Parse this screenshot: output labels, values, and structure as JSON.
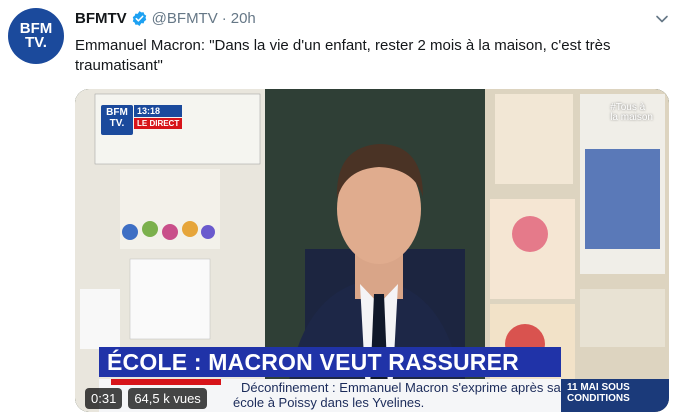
{
  "tweet": {
    "author_name": "BFMTV",
    "handle": "@BFMTV",
    "separator": "·",
    "time": "20h",
    "text": "Emmanuel Macron: \"Dans la vie d'un enfant, rester 2 mois à la maison, c'est très traumatisant\"",
    "avatar_text_line1": "BFM",
    "avatar_text_line2": "TV."
  },
  "video": {
    "channel_logo_line1": "BFM",
    "channel_logo_line2": "TV.",
    "clock": "13:18",
    "live_label": "LE DIRECT",
    "watermark_line1": "#Tous à",
    "watermark_line2": "la maison",
    "headline": "ÉCOLE : MACRON VEUT RASSURER",
    "ticker_line1": "Déconfinement : Emmanuel Macron s'exprime après sa",
    "ticker_line2": "école à Poissy dans les Yvelines.",
    "side_line1": "11 MAI SOUS",
    "side_line2": "CONDITIONS",
    "duration": "0:31",
    "views": "64,5 k vues"
  },
  "colors": {
    "brand_blue": "#1b4a9c",
    "chyron_blue": "#2033a8",
    "live_red": "#d7141a",
    "verified_blue": "#1da1f2",
    "muted_text": "#657786"
  }
}
